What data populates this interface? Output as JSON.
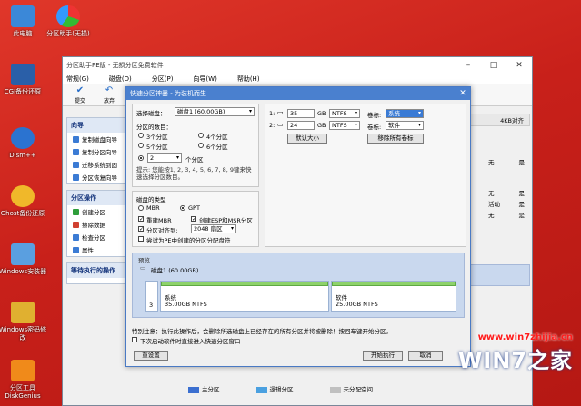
{
  "desktop": {
    "icons": [
      {
        "label": "此电脑"
      },
      {
        "label": "分区助手(无损)"
      },
      {
        "label": "CGI备份还原"
      },
      {
        "label": "Dism++"
      },
      {
        "label": "Ghost备份还原"
      },
      {
        "label": "Windows安装器"
      },
      {
        "label": "Windows密码修改"
      },
      {
        "label": "分区工具DiskGenius"
      }
    ]
  },
  "main_window": {
    "title": "分区助手PE版 - 无损分区免费软件",
    "menu": [
      "常规(G)",
      "磁盘(D)",
      "分区(P)",
      "向导(W)",
      "帮助(H)"
    ],
    "toolbar": [
      "提交",
      "放弃"
    ],
    "sidebar": {
      "wizard": {
        "header": "向导",
        "items": [
          "复制磁盘向导",
          "复制分区向导",
          "迁移系统到固",
          "分区恢复向导"
        ]
      },
      "ops": {
        "header": "分区操作",
        "items": [
          "创建分区",
          "擦除数据",
          "检查分区",
          "属性"
        ]
      },
      "pending": {
        "header": "等待执行的操作"
      }
    },
    "right_column": {
      "header": "4KB对齐",
      "rows": [
        [
          "无",
          "是"
        ],
        [
          "无",
          "是"
        ],
        [
          "活动",
          "是"
        ],
        [
          "无",
          "是"
        ]
      ]
    },
    "legend": [
      "主分区",
      "逻辑分区",
      "未分配空间"
    ]
  },
  "dialog": {
    "title": "快速分区神器 - 为装机而生",
    "select_disk_label": "选择磁盘：",
    "select_disk_value": "磁盘1 (60.00GB)",
    "partition_count_label": "分区的数目：",
    "radio_options": [
      "3个分区",
      "4个分区",
      "5个分区",
      "6个分区"
    ],
    "custom_count_value": "2",
    "custom_count_suffix": "个分区",
    "hint": "提示: 您能按1, 2, 3, 4, 5, 6, 7, 8, 9键来快速选择分区数目。",
    "disk_type_label": "磁盘的类型",
    "disk_types": [
      "MBR",
      "GPT"
    ],
    "checkboxes": [
      "重建MBR",
      "创建ESP和MSR分区",
      "分区对齐到:",
      "尝试为PE中创建的分区分配盘符"
    ],
    "align_value": "2048 扇区",
    "partitions": [
      {
        "num": "1:",
        "size": "35",
        "unit": "GB",
        "fs": "NTFS",
        "label_text": "卷标:",
        "label_value": "系统"
      },
      {
        "num": "2:",
        "size": "24",
        "unit": "GB",
        "fs": "NTFS",
        "label_text": "卷标:",
        "label_value": "软件"
      }
    ],
    "default_size_btn": "默认大小",
    "remove_labels_btn": "移除所有卷标",
    "preview_label": "预览",
    "preview_disk": "磁盘1 (60.00GB)",
    "preview_parts": [
      {
        "name": "系统",
        "size": "35.00GB NTFS"
      },
      {
        "name": "软件",
        "size": "25.00GB NTFS"
      }
    ],
    "preview_num": "3",
    "warning": "特别注意：执行此操作后，会删除所选磁盘上已经存在的所有分区并将被删除！按回车键开始分区。",
    "remember_option": "下次启动软件时直接进入快速分区窗口",
    "reset_btn": "重设置",
    "start_btn": "开始执行",
    "cancel_btn": "取消"
  },
  "watermark": {
    "url": "www.win7zhijia.cn",
    "brand": "WIN7之家"
  },
  "colors": {
    "desktop": "#c8201a",
    "accent": "#4a80cf",
    "green_bar": "#8dd26a"
  }
}
